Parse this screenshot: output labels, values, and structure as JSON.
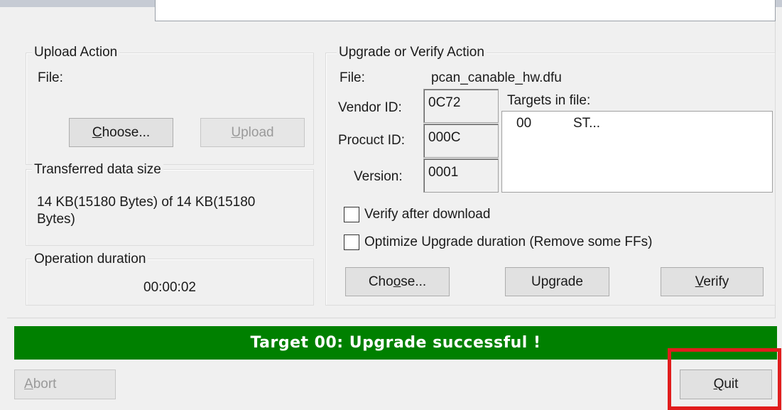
{
  "upload": {
    "group_label": "Upload Action",
    "file_label": "File:",
    "choose_label": "Choose...",
    "upload_label": "Upload"
  },
  "transferred": {
    "group_label": "Transferred data size",
    "text_line1": "14 KB(15180 Bytes) of 14 KB(15180",
    "text_line2": "Bytes)"
  },
  "duration": {
    "group_label": "Operation duration",
    "value": "00:00:02"
  },
  "upgrade": {
    "group_label": "Upgrade or Verify Action",
    "file_label": "File:",
    "file_name": "pcan_canable_hw.dfu",
    "vendor_label": "Vendor ID:",
    "vendor_value": "0C72",
    "product_label": "Procuct ID:",
    "product_value": "000C",
    "version_label": "Version:",
    "version_value": "0001",
    "targets_label": "Targets in file:",
    "target_rows": [
      {
        "id": "00",
        "name": "ST..."
      }
    ],
    "verify_checkbox_label": "Verify after download",
    "verify_checked": false,
    "optimize_checkbox_label": "Optimize Upgrade duration (Remove some FFs)",
    "optimize_checked": false,
    "choose_label": "Choose...",
    "upgrade_label": "Upgrade",
    "verify_label": "Verify"
  },
  "status": {
    "message": "Target 00: Upgrade successful !",
    "color": "#008000"
  },
  "footer": {
    "abort_label": "Abort",
    "quit_label": "Quit"
  },
  "highlight_color": "#e11d1d"
}
